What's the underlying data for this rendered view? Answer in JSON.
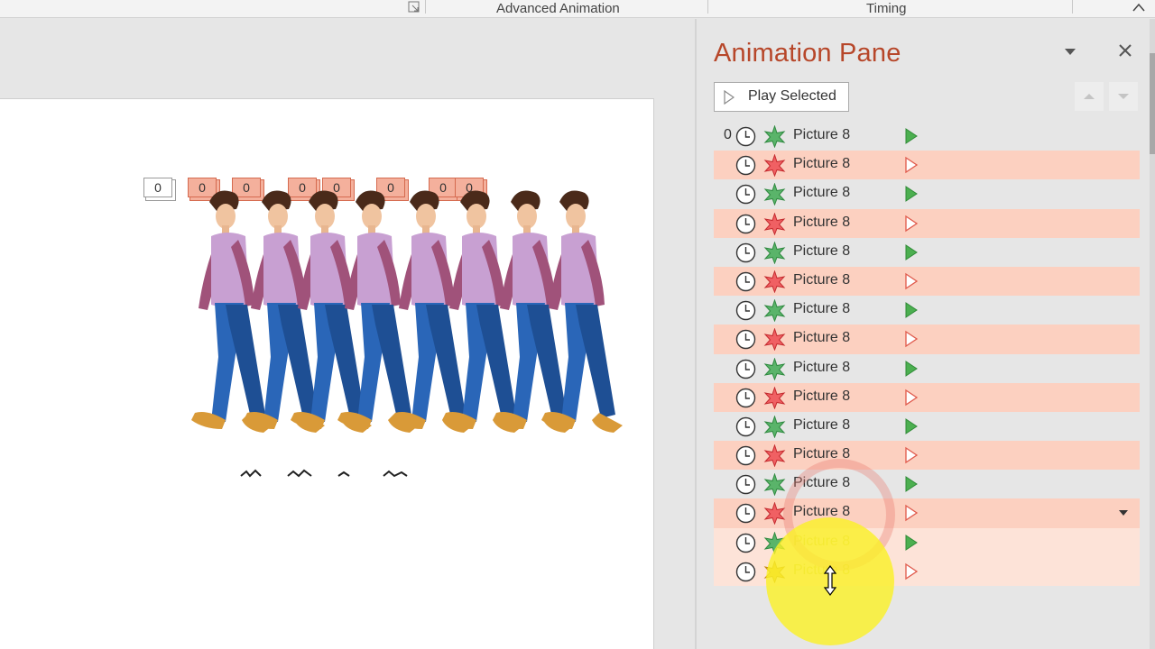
{
  "ribbon": {
    "groups": [
      {
        "label": "Advanced Animation"
      },
      {
        "label": "Timing"
      }
    ]
  },
  "slide": {
    "trigger_tags": [
      "0",
      "0",
      "0",
      "0",
      "0",
      "0",
      "0",
      "0"
    ]
  },
  "pane": {
    "title": "Animation Pane",
    "play_label": "Play Selected",
    "items": [
      {
        "num": "0",
        "effect": "entrance",
        "name": "Picture 8"
      },
      {
        "num": "",
        "effect": "exit",
        "name": "Picture 8"
      },
      {
        "num": "",
        "effect": "entrance",
        "name": "Picture 8"
      },
      {
        "num": "",
        "effect": "exit",
        "name": "Picture 8"
      },
      {
        "num": "",
        "effect": "entrance",
        "name": "Picture 8"
      },
      {
        "num": "",
        "effect": "exit",
        "name": "Picture 8"
      },
      {
        "num": "",
        "effect": "entrance",
        "name": "Picture 8"
      },
      {
        "num": "",
        "effect": "exit",
        "name": "Picture 8"
      },
      {
        "num": "",
        "effect": "entrance",
        "name": "Picture 8"
      },
      {
        "num": "",
        "effect": "exit",
        "name": "Picture 8"
      },
      {
        "num": "",
        "effect": "entrance",
        "name": "Picture 8"
      },
      {
        "num": "",
        "effect": "exit",
        "name": "Picture 8"
      },
      {
        "num": "",
        "effect": "entrance",
        "name": "Picture 8"
      },
      {
        "num": "",
        "effect": "exit",
        "name": "Picture 8"
      },
      {
        "num": "",
        "effect": "entrance",
        "name": "Picture 8"
      },
      {
        "num": "",
        "effect": "exit",
        "name": "Picture 8"
      }
    ]
  },
  "colors": {
    "title_accent": "#b7472a",
    "exit_row": "#fcd0c0",
    "entrance_star": "#3fa34d",
    "exit_star": "#e0383b",
    "play_green": "#4caf50"
  },
  "icons": [
    "dialog-launcher-icon",
    "collapse-ribbon-icon",
    "pane-options-icon",
    "close-icon",
    "play-icon",
    "move-up-icon",
    "move-down-icon",
    "clock-icon",
    "entrance-star-icon",
    "exit-star-icon",
    "dropdown-icon",
    "resize-cursor-icon"
  ]
}
